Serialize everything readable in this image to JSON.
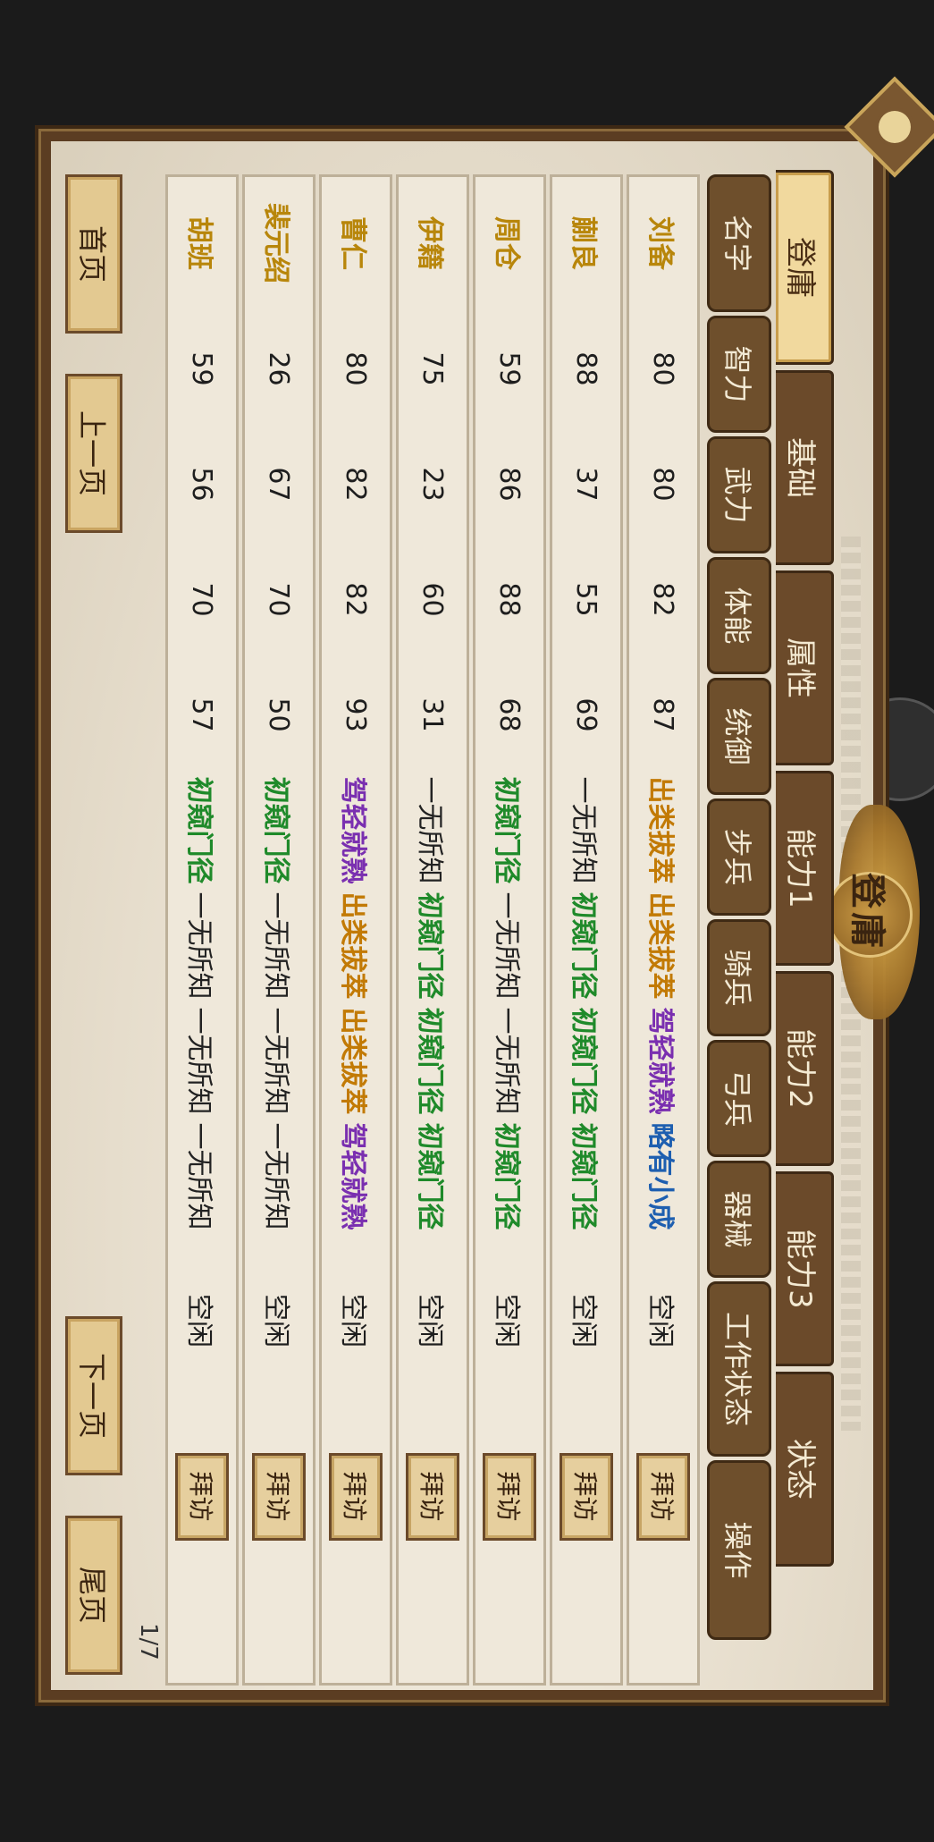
{
  "title": "登庸",
  "tabs": [
    {
      "label": "登庸",
      "active": true
    },
    {
      "label": "基础",
      "active": false
    },
    {
      "label": "属性",
      "active": false
    },
    {
      "label": "能力1",
      "active": false
    },
    {
      "label": "能力2",
      "active": false
    },
    {
      "label": "能力3",
      "active": false
    },
    {
      "label": "状态",
      "active": false
    }
  ],
  "columns": [
    "名字",
    "智力",
    "武力",
    "体能",
    "统御",
    "步兵",
    "骑兵",
    "弓兵",
    "器械",
    "工作状态",
    "操作"
  ],
  "action_label": "拜访",
  "skill_tiers": {
    "一无所知": "tier-0",
    "初窥门径": "tier-1",
    "略有小成": "tier-2",
    "驾轻就熟": "tier-3",
    "出类拔萃": "tier-4"
  },
  "rows": [
    {
      "name": "刘备",
      "int": "80",
      "str": "80",
      "sta": "82",
      "lead": "87",
      "infantry": "出类拔萃",
      "cavalry": "出类拔萃",
      "archer": "驾轻就熟",
      "siege": "略有小成",
      "status": "空闲"
    },
    {
      "name": "蒯良",
      "int": "88",
      "str": "37",
      "sta": "55",
      "lead": "69",
      "infantry": "一无所知",
      "cavalry": "初窥门径",
      "archer": "初窥门径",
      "siege": "初窥门径",
      "status": "空闲"
    },
    {
      "name": "周仓",
      "int": "59",
      "str": "86",
      "sta": "88",
      "lead": "68",
      "infantry": "初窥门径",
      "cavalry": "一无所知",
      "archer": "一无所知",
      "siege": "初窥门径",
      "status": "空闲"
    },
    {
      "name": "伊籍",
      "int": "75",
      "str": "23",
      "sta": "60",
      "lead": "31",
      "infantry": "一无所知",
      "cavalry": "初窥门径",
      "archer": "初窥门径",
      "siege": "初窥门径",
      "status": "空闲"
    },
    {
      "name": "曹仁",
      "int": "80",
      "str": "82",
      "sta": "82",
      "lead": "93",
      "infantry": "驾轻就熟",
      "cavalry": "出类拔萃",
      "archer": "出类拔萃",
      "siege": "驾轻就熟",
      "status": "空闲"
    },
    {
      "name": "裴元绍",
      "int": "26",
      "str": "67",
      "sta": "70",
      "lead": "50",
      "infantry": "初窥门径",
      "cavalry": "一无所知",
      "archer": "一无所知",
      "siege": "一无所知",
      "status": "空闲"
    },
    {
      "name": "胡班",
      "int": "59",
      "str": "56",
      "sta": "70",
      "lead": "57",
      "infantry": "初窥门径",
      "cavalry": "一无所知",
      "archer": "一无所知",
      "siege": "一无所知",
      "status": "空闲"
    }
  ],
  "pager": {
    "first": "首页",
    "prev": "上一页",
    "next": "下一页",
    "last": "尾页",
    "indicator": "1/7"
  }
}
